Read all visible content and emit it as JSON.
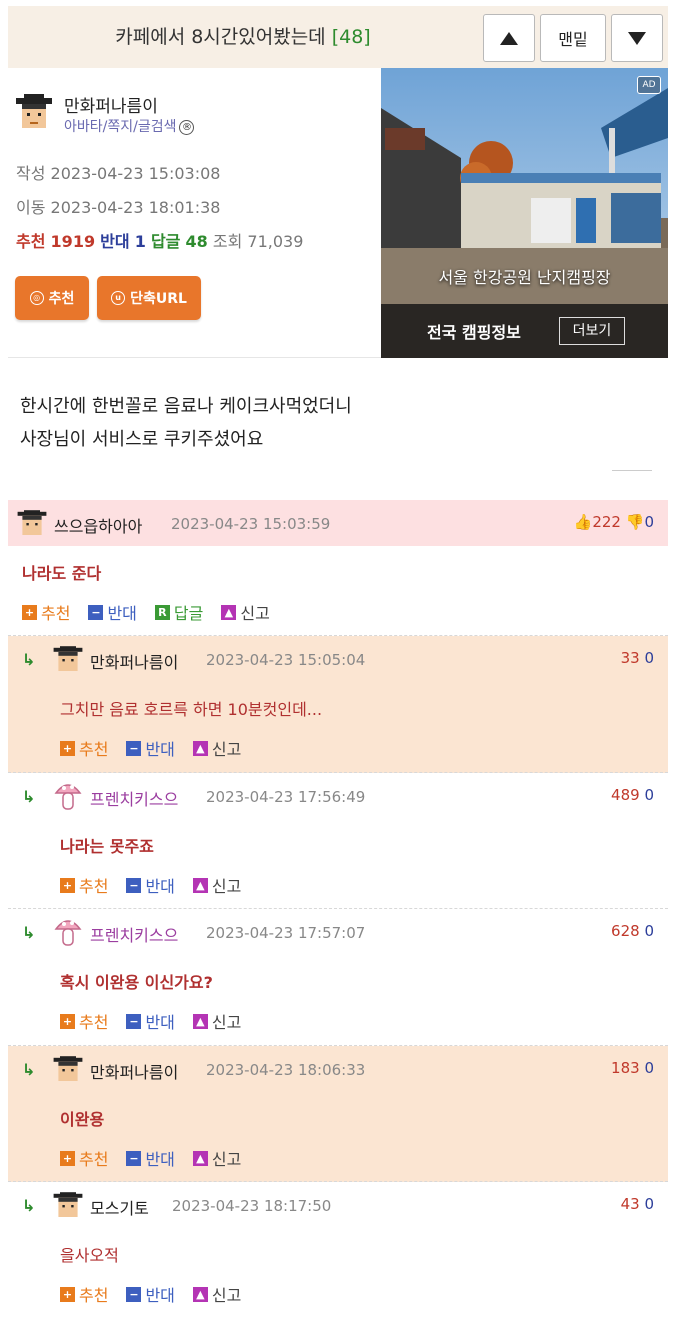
{
  "topbar": {
    "title": "카페에서 8시간있어봤는데",
    "comment_count": "[48]",
    "bottom_label": "맨밑"
  },
  "author": {
    "nickname": "만화퍼나름이",
    "menu": "아바타/쪽지/글검색",
    "menu_badge": "®"
  },
  "meta": {
    "written_label": "작성",
    "written": "2023-04-23 15:03:08",
    "moved_label": "이동",
    "moved": "2023-04-23 18:01:38"
  },
  "stats": {
    "rec_label": "추천",
    "rec": "1919",
    "opp_label": "반대",
    "opp": "1",
    "reply_label": "답글",
    "reply": "48",
    "views_label": "조회",
    "views": "71,039"
  },
  "buttons": {
    "recommend": "추천",
    "short_url": "단축URL"
  },
  "ad": {
    "caption": "서울 한강공원 난지캠핑장",
    "title": "전국 캠핑정보",
    "more": "더보기",
    "tag": "AD"
  },
  "post": {
    "line1": "한시간에 한번꼴로 음료나 케이크사먹었더니",
    "line2": "사장님이 서비스로 쿠키주셨어요"
  },
  "actions": {
    "recommend": "추천",
    "oppose": "반대",
    "reply": "답글",
    "report": "신고"
  },
  "comments": [
    {
      "nick": "쓰으읍하아아",
      "date": "2023-04-23 15:03:59",
      "up": "222",
      "down": "0",
      "text": "나라도 준다"
    },
    {
      "nick": "만화퍼나름이",
      "date": "2023-04-23 15:05:04",
      "up": "33",
      "down": "0",
      "text": "그치만 음료 호르륵 하면 10분컷인데..."
    },
    {
      "nick": "프렌치키스으",
      "date": "2023-04-23 17:56:49",
      "up": "489",
      "down": "0",
      "text": "나라는 못주죠"
    },
    {
      "nick": "프렌치키스으",
      "date": "2023-04-23 17:57:07",
      "up": "628",
      "down": "0",
      "text": "혹시 이완용 이신가요?"
    },
    {
      "nick": "만화퍼나름이",
      "date": "2023-04-23 18:06:33",
      "up": "183",
      "down": "0",
      "text": "이완용"
    },
    {
      "nick": "모스기토",
      "date": "2023-04-23 18:17:50",
      "up": "43",
      "down": "0",
      "text": "을사오적"
    }
  ],
  "colors": {
    "accent_orange": "#e8762b",
    "recommend_red": "#c0392b",
    "oppose_blue": "#2c3e9a",
    "reply_green": "#2e8b2e",
    "comment_highlight": "#fde0e1",
    "author_reply_bg": "#fbe5d2"
  }
}
